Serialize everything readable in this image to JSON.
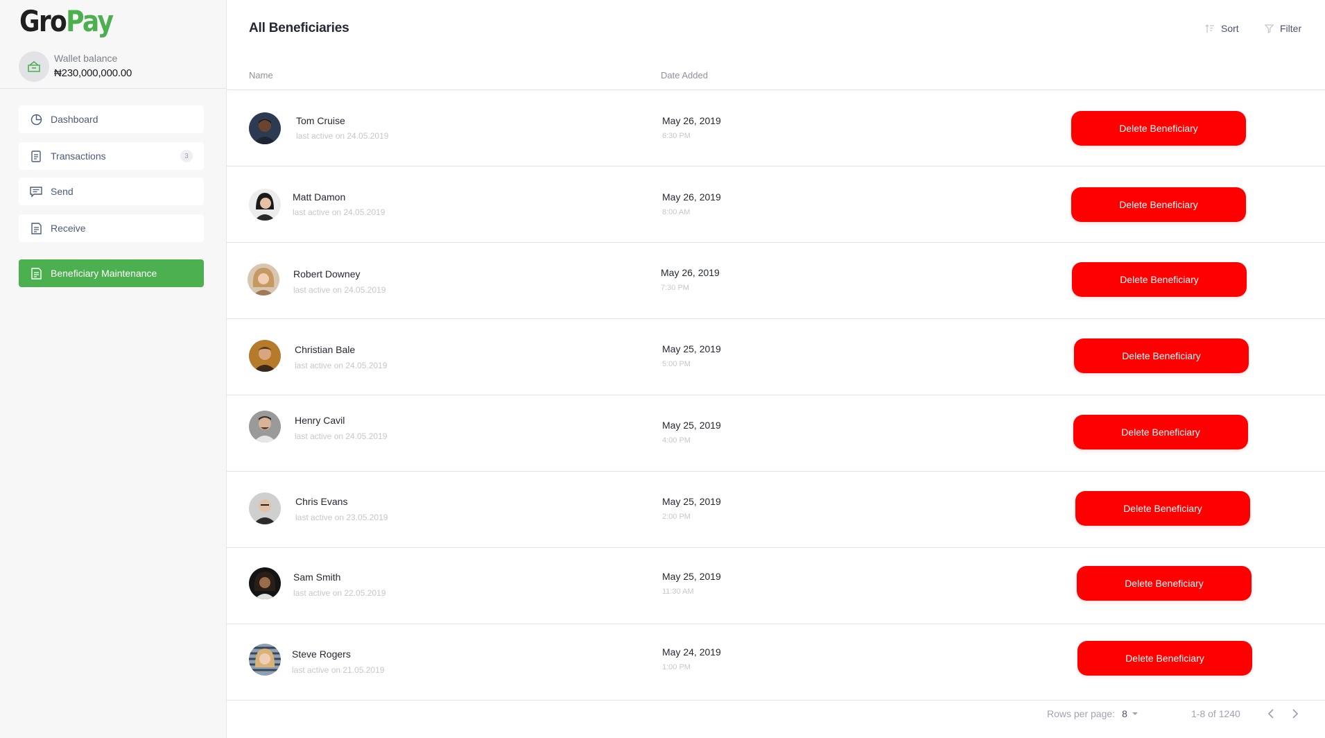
{
  "brand": {
    "part1": "Gro",
    "part2": "Pay",
    "accent": "#4caf50"
  },
  "wallet": {
    "label": "Wallet balance",
    "value": "₦230,000,000.00",
    "icon": "wallet-icon"
  },
  "nav": {
    "dashboard": {
      "label": "Dashboard",
      "icon": "pie-chart-icon"
    },
    "transactions": {
      "label": "Transactions",
      "badge": "3",
      "icon": "document-icon"
    },
    "send": {
      "label": "Send",
      "icon": "message-icon"
    },
    "receive": {
      "label": "Receive",
      "icon": "receipt-icon"
    },
    "beneficiary": {
      "label": "Beneficiary Maintenance",
      "icon": "receipt-icon",
      "active": true
    }
  },
  "page": {
    "title": "All Beneficiaries"
  },
  "toolbar": {
    "sort_label": "Sort",
    "filter_label": "Filter"
  },
  "table": {
    "col_name": "Name",
    "col_date": "Date Added",
    "delete_label": "Delete Beneficiary",
    "delete_color": "#ff0000",
    "rows": [
      {
        "name": "Tom Cruise",
        "sub": "last active on 24.05.2019",
        "date": "May 26, 2019",
        "time": "6:30 PM"
      },
      {
        "name": "Matt Damon",
        "sub": "last active on 24.05.2019",
        "date": "May 26, 2019",
        "time": "8:00 AM"
      },
      {
        "name": "Robert Downey",
        "sub": "last active on 24.05.2019",
        "date": "May 26, 2019",
        "time": "7:30 PM"
      },
      {
        "name": "Christian Bale",
        "sub": "last active on 24.05.2019",
        "date": "May 25, 2019",
        "time": "5:00 PM"
      },
      {
        "name": "Henry Cavil",
        "sub": "last active on 24.05.2019",
        "date": "May 25, 2019",
        "time": "4:00 PM"
      },
      {
        "name": "Chris Evans",
        "sub": "last active on 23.05.2019",
        "date": "May 25, 2019",
        "time": "2:00 PM"
      },
      {
        "name": "Sam Smith",
        "sub": "last active on 22.05.2019",
        "date": "May 25, 2019",
        "time": "11:30 AM"
      },
      {
        "name": "Steve Rogers",
        "sub": "last active on 21.05.2019",
        "date": "May 24, 2019",
        "time": "1:00 PM"
      }
    ]
  },
  "pagination": {
    "rows_label": "Rows per page:",
    "rows_value": "8",
    "range": "1-8 of 1240"
  }
}
